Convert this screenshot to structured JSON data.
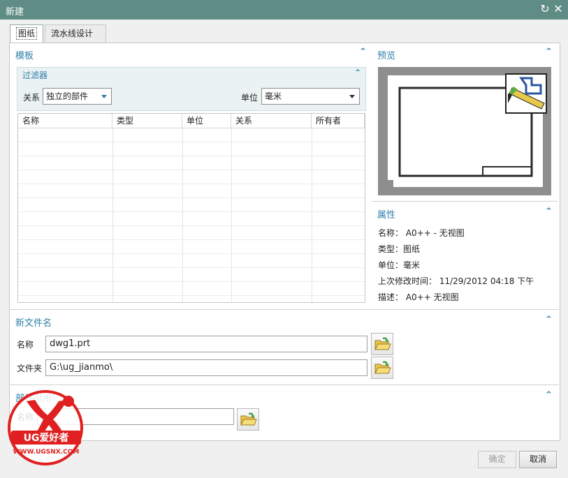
{
  "window": {
    "title": "新建"
  },
  "tabs": [
    {
      "label": "图纸"
    },
    {
      "label": "流水线设计器"
    }
  ],
  "template": {
    "title": "模板",
    "filter": {
      "title": "过滤器",
      "relation_label": "关系",
      "relation_value": "独立的部件",
      "unit_label": "单位",
      "unit_value": "毫米"
    },
    "columns": [
      "名称",
      "类型",
      "单位",
      "关系",
      "所有者"
    ]
  },
  "preview": {
    "title": "预览"
  },
  "properties": {
    "title": "属性",
    "items": [
      {
        "label": "名称：",
        "value": "A0++ - 无视图"
      },
      {
        "label": "类型：",
        "value": "图纸"
      },
      {
        "label": "单位：",
        "value": "毫米"
      },
      {
        "label": "上次修改时间：",
        "value": "11/29/2012 04:18 下午"
      },
      {
        "label": "描述：",
        "value": "A0++ 无视图"
      }
    ]
  },
  "new_file": {
    "title": "新文件名",
    "name_label": "名称",
    "name_value": "dwg1.prt",
    "folder_label": "文件夹",
    "folder_value": "G:\\ug_jianmo\\"
  },
  "part": {
    "title": "部件引用",
    "name_label": "名称",
    "name_value": ""
  },
  "buttons": {
    "ok": "确定",
    "cancel": "取消"
  },
  "watermark": {
    "brand": "UG爱好者",
    "url": "WWW.UGSNX.COM"
  }
}
